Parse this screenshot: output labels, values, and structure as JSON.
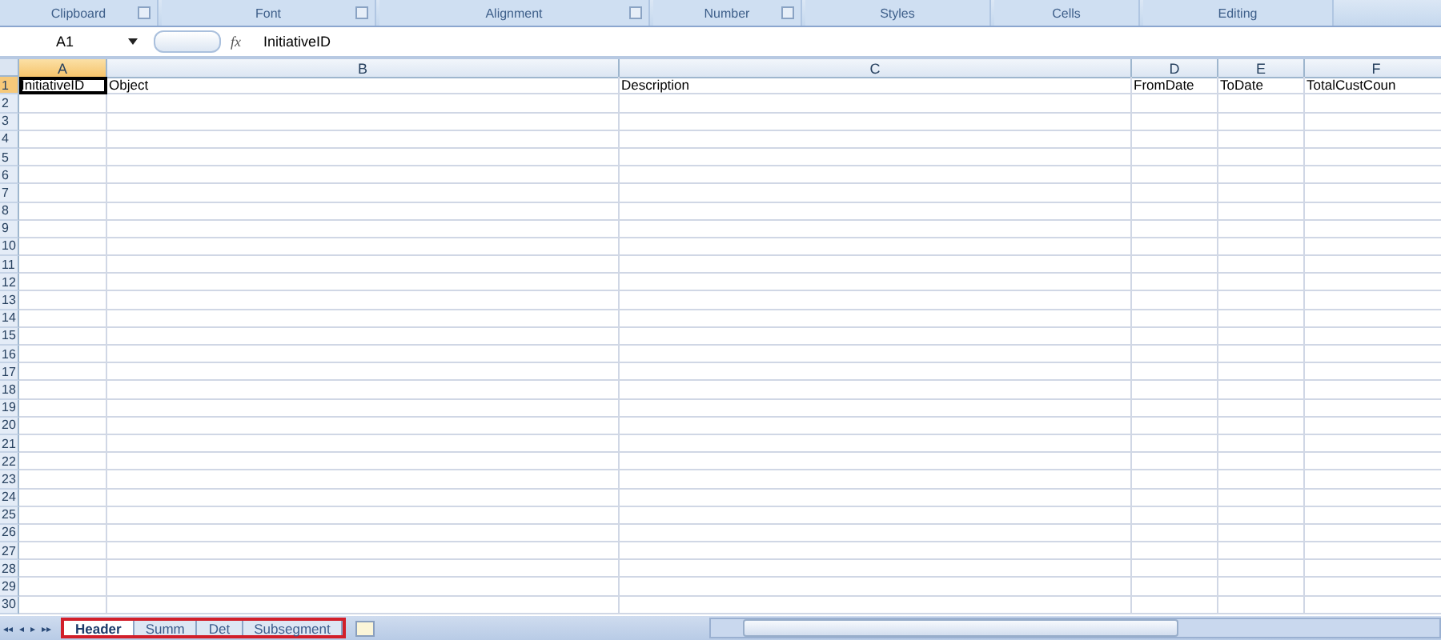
{
  "ribbon_groups": [
    {
      "label": "Clipboard",
      "launcher": true
    },
    {
      "label": "Font",
      "launcher": true
    },
    {
      "label": "Alignment",
      "launcher": true
    },
    {
      "label": "Number",
      "launcher": true
    },
    {
      "label": "Styles",
      "launcher": false
    },
    {
      "label": "Cells",
      "launcher": false
    },
    {
      "label": "Editing",
      "launcher": false
    }
  ],
  "formula_bar": {
    "name_box": "A1",
    "function_symbol": "fx",
    "value": "InitiativeID"
  },
  "sheet_nav": [
    "◂◂",
    "◂",
    "▸",
    "▸▸"
  ],
  "columns": [
    {
      "label": "A",
      "selected": true
    },
    {
      "label": "B",
      "selected": false
    },
    {
      "label": "C",
      "selected": false
    },
    {
      "label": "D",
      "selected": false
    },
    {
      "label": "E",
      "selected": false
    },
    {
      "label": "F",
      "selected": false
    }
  ],
  "rows": [
    {
      "number": "1",
      "selected": true,
      "cells": [
        "InitiativeID",
        "Object",
        "Description",
        "FromDate",
        "ToDate",
        "TotalCustCoun"
      ]
    },
    {
      "number": "2",
      "selected": false
    },
    {
      "number": "3",
      "selected": false
    },
    {
      "number": "4",
      "selected": false
    },
    {
      "number": "5",
      "selected": false
    },
    {
      "number": "6",
      "selected": false
    },
    {
      "number": "7",
      "selected": false
    },
    {
      "number": "8",
      "selected": false
    },
    {
      "number": "9",
      "selected": false
    },
    {
      "number": "10",
      "selected": false
    },
    {
      "number": "11",
      "selected": false
    },
    {
      "number": "12",
      "selected": false
    },
    {
      "number": "13",
      "selected": false
    },
    {
      "number": "14",
      "selected": false
    },
    {
      "number": "15",
      "selected": false
    },
    {
      "number": "16",
      "selected": false
    },
    {
      "number": "17",
      "selected": false
    },
    {
      "number": "18",
      "selected": false
    },
    {
      "number": "19",
      "selected": false
    },
    {
      "number": "20",
      "selected": false
    },
    {
      "number": "21",
      "selected": false
    },
    {
      "number": "22",
      "selected": false
    },
    {
      "number": "23",
      "selected": false
    },
    {
      "number": "24",
      "selected": false
    },
    {
      "number": "25",
      "selected": false
    },
    {
      "number": "26",
      "selected": false
    },
    {
      "number": "27",
      "selected": false
    },
    {
      "number": "28",
      "selected": false
    },
    {
      "number": "29",
      "selected": false
    },
    {
      "number": "30",
      "selected": false
    }
  ],
  "sheet_tabs": [
    {
      "label": "Header",
      "selected": true
    },
    {
      "label": "Summ",
      "selected": false
    },
    {
      "label": "Det",
      "selected": false
    },
    {
      "label": "Subsegment",
      "selected": false
    }
  ]
}
